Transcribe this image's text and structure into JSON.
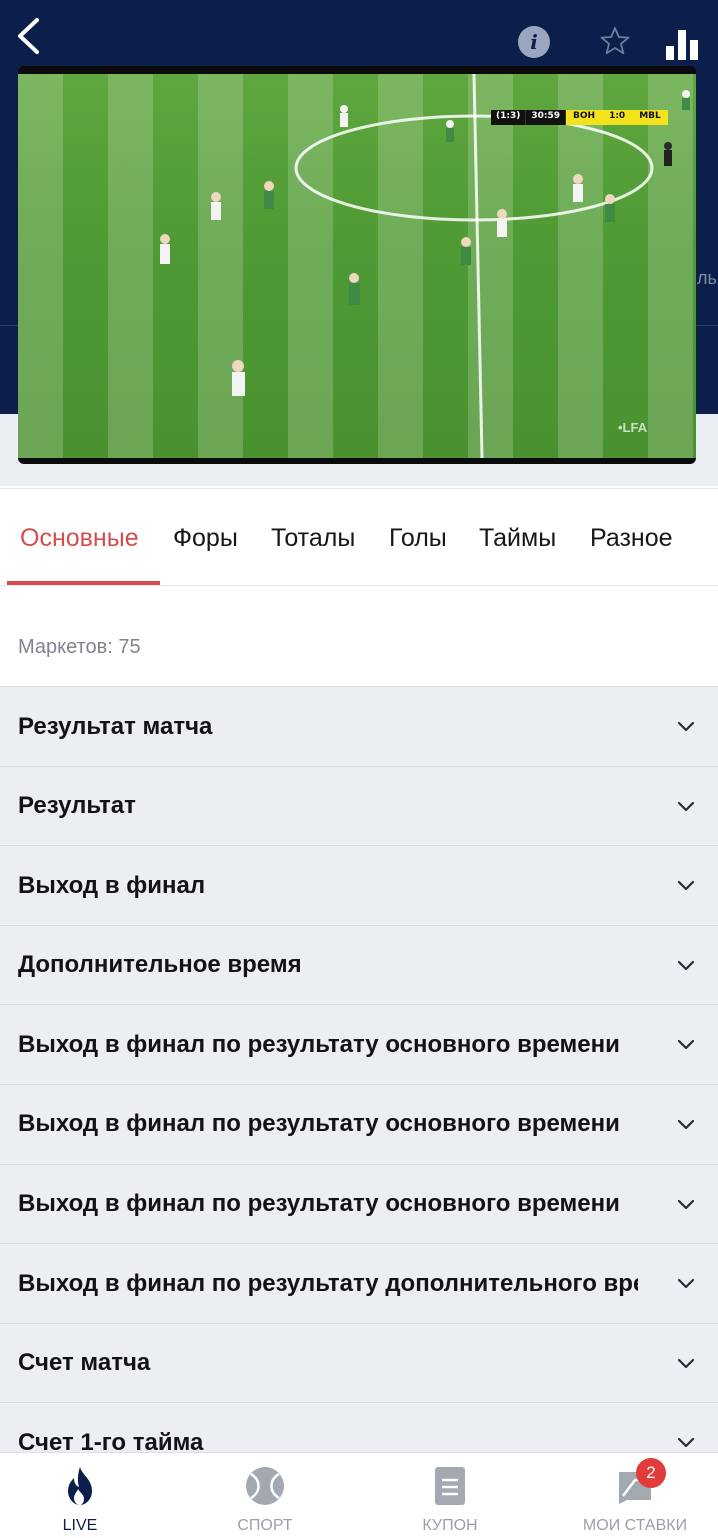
{
  "header": {
    "back_label": "<",
    "info_label": "i",
    "star_label": "☆",
    "edge_right": "ль",
    "background": "#0b1f4a"
  },
  "video": {
    "scoreboard": {
      "period": "(1:3)",
      "clock": "30:59",
      "home": "BOH",
      "score": "1:0",
      "away": "MBL"
    },
    "watermark": "•LFA"
  },
  "tabs": [
    {
      "label": "Основные",
      "active": true
    },
    {
      "label": "Форы",
      "active": false
    },
    {
      "label": "Тоталы",
      "active": false
    },
    {
      "label": "Голы",
      "active": false
    },
    {
      "label": "Таймы",
      "active": false
    },
    {
      "label": "Разное",
      "active": false
    }
  ],
  "markets_count": "Маркетов: 75",
  "markets": [
    {
      "title": "Результат матча"
    },
    {
      "title": "Результат"
    },
    {
      "title": "Выход в финал"
    },
    {
      "title": "Дополнительное время"
    },
    {
      "title": "Выход в финал по результату основного времени"
    },
    {
      "title": "Выход в финал по результату основного времени"
    },
    {
      "title": "Выход в финал по результату основного времени"
    },
    {
      "title": "Выход в финал по результату дополнительного времени"
    },
    {
      "title": "Счет матча"
    },
    {
      "title": "Счет 1-го тайма"
    }
  ],
  "bottom_nav": [
    {
      "label": "LIVE",
      "icon": "flame-icon",
      "active": true
    },
    {
      "label": "СПОРТ",
      "icon": "tennis-ball-icon",
      "active": false
    },
    {
      "label": "КУПОН",
      "icon": "coupon-icon",
      "active": false
    },
    {
      "label": "МОИ СТАВКИ",
      "icon": "my-bets-icon",
      "active": false
    }
  ],
  "bets_badge": "2",
  "colors": {
    "accent": "#d54d4d",
    "header": "#0b1f4a",
    "row_bg": "#ebeef2",
    "badge": "#e23b3b"
  }
}
